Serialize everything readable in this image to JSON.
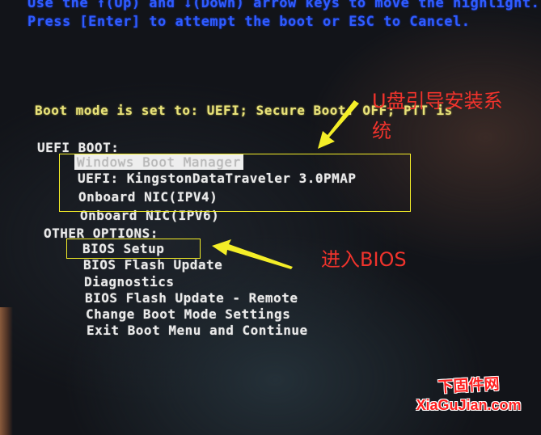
{
  "instructions": {
    "line1": "Use the ↑(Up) and ↓(Down) arrow keys to move the highlight.",
    "line2": "Press [Enter] to attempt the boot or ESC to Cancel."
  },
  "boot_mode": "Boot mode is set to: UEFI; Secure Boot: OFF; PTT is",
  "uefi_boot": {
    "header": "UEFI BOOT:",
    "items": [
      {
        "label": "Windows Boot Manager",
        "selected": true
      },
      {
        "label": "UEFI: KingstonDataTraveler 3.0PMAP",
        "selected": false
      },
      {
        "label": "Onboard NIC(IPV4)",
        "selected": false
      },
      {
        "label": "Onboard NIC(IPV6)",
        "selected": false
      }
    ]
  },
  "other_options": {
    "header": "OTHER OPTIONS:",
    "items": [
      {
        "label": "BIOS Setup"
      },
      {
        "label": "BIOS Flash Update"
      },
      {
        "label": "Diagnostics"
      },
      {
        "label": "BIOS Flash Update - Remote"
      },
      {
        "label": "Change Boot Mode Settings"
      },
      {
        "label": "Exit Boot Menu and Continue"
      }
    ]
  },
  "annotations": {
    "usb_boot_line1": "U盘引导安装系",
    "usb_boot_line2": "统",
    "enter_bios": "进入BIOS",
    "highlight_color": "#f4ee28",
    "text_color": "#f0332c"
  },
  "watermark": {
    "chinese": "下固件网",
    "domain": "XiaGuJian.com"
  },
  "colors": {
    "instruction_blue": "#2f5cff",
    "boot_mode_yellow": "#e8e27a",
    "menu_white": "#e9e9e9"
  }
}
